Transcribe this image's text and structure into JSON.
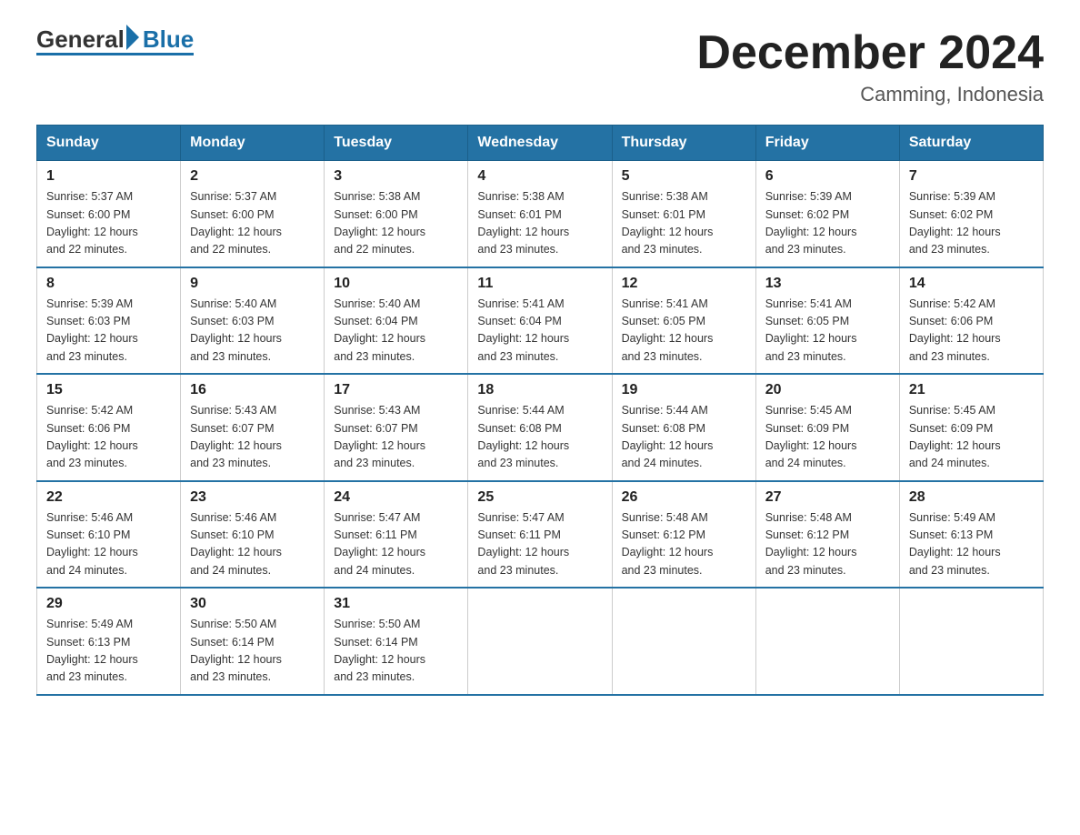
{
  "header": {
    "logo_general": "General",
    "logo_blue": "Blue",
    "month_title": "December 2024",
    "location": "Camming, Indonesia"
  },
  "columns": [
    "Sunday",
    "Monday",
    "Tuesday",
    "Wednesday",
    "Thursday",
    "Friday",
    "Saturday"
  ],
  "weeks": [
    [
      {
        "day": "1",
        "sunrise": "5:37 AM",
        "sunset": "6:00 PM",
        "daylight": "12 hours and 22 minutes."
      },
      {
        "day": "2",
        "sunrise": "5:37 AM",
        "sunset": "6:00 PM",
        "daylight": "12 hours and 22 minutes."
      },
      {
        "day": "3",
        "sunrise": "5:38 AM",
        "sunset": "6:00 PM",
        "daylight": "12 hours and 22 minutes."
      },
      {
        "day": "4",
        "sunrise": "5:38 AM",
        "sunset": "6:01 PM",
        "daylight": "12 hours and 23 minutes."
      },
      {
        "day": "5",
        "sunrise": "5:38 AM",
        "sunset": "6:01 PM",
        "daylight": "12 hours and 23 minutes."
      },
      {
        "day": "6",
        "sunrise": "5:39 AM",
        "sunset": "6:02 PM",
        "daylight": "12 hours and 23 minutes."
      },
      {
        "day": "7",
        "sunrise": "5:39 AM",
        "sunset": "6:02 PM",
        "daylight": "12 hours and 23 minutes."
      }
    ],
    [
      {
        "day": "8",
        "sunrise": "5:39 AM",
        "sunset": "6:03 PM",
        "daylight": "12 hours and 23 minutes."
      },
      {
        "day": "9",
        "sunrise": "5:40 AM",
        "sunset": "6:03 PM",
        "daylight": "12 hours and 23 minutes."
      },
      {
        "day": "10",
        "sunrise": "5:40 AM",
        "sunset": "6:04 PM",
        "daylight": "12 hours and 23 minutes."
      },
      {
        "day": "11",
        "sunrise": "5:41 AM",
        "sunset": "6:04 PM",
        "daylight": "12 hours and 23 minutes."
      },
      {
        "day": "12",
        "sunrise": "5:41 AM",
        "sunset": "6:05 PM",
        "daylight": "12 hours and 23 minutes."
      },
      {
        "day": "13",
        "sunrise": "5:41 AM",
        "sunset": "6:05 PM",
        "daylight": "12 hours and 23 minutes."
      },
      {
        "day": "14",
        "sunrise": "5:42 AM",
        "sunset": "6:06 PM",
        "daylight": "12 hours and 23 minutes."
      }
    ],
    [
      {
        "day": "15",
        "sunrise": "5:42 AM",
        "sunset": "6:06 PM",
        "daylight": "12 hours and 23 minutes."
      },
      {
        "day": "16",
        "sunrise": "5:43 AM",
        "sunset": "6:07 PM",
        "daylight": "12 hours and 23 minutes."
      },
      {
        "day": "17",
        "sunrise": "5:43 AM",
        "sunset": "6:07 PM",
        "daylight": "12 hours and 23 minutes."
      },
      {
        "day": "18",
        "sunrise": "5:44 AM",
        "sunset": "6:08 PM",
        "daylight": "12 hours and 23 minutes."
      },
      {
        "day": "19",
        "sunrise": "5:44 AM",
        "sunset": "6:08 PM",
        "daylight": "12 hours and 24 minutes."
      },
      {
        "day": "20",
        "sunrise": "5:45 AM",
        "sunset": "6:09 PM",
        "daylight": "12 hours and 24 minutes."
      },
      {
        "day": "21",
        "sunrise": "5:45 AM",
        "sunset": "6:09 PM",
        "daylight": "12 hours and 24 minutes."
      }
    ],
    [
      {
        "day": "22",
        "sunrise": "5:46 AM",
        "sunset": "6:10 PM",
        "daylight": "12 hours and 24 minutes."
      },
      {
        "day": "23",
        "sunrise": "5:46 AM",
        "sunset": "6:10 PM",
        "daylight": "12 hours and 24 minutes."
      },
      {
        "day": "24",
        "sunrise": "5:47 AM",
        "sunset": "6:11 PM",
        "daylight": "12 hours and 24 minutes."
      },
      {
        "day": "25",
        "sunrise": "5:47 AM",
        "sunset": "6:11 PM",
        "daylight": "12 hours and 23 minutes."
      },
      {
        "day": "26",
        "sunrise": "5:48 AM",
        "sunset": "6:12 PM",
        "daylight": "12 hours and 23 minutes."
      },
      {
        "day": "27",
        "sunrise": "5:48 AM",
        "sunset": "6:12 PM",
        "daylight": "12 hours and 23 minutes."
      },
      {
        "day": "28",
        "sunrise": "5:49 AM",
        "sunset": "6:13 PM",
        "daylight": "12 hours and 23 minutes."
      }
    ],
    [
      {
        "day": "29",
        "sunrise": "5:49 AM",
        "sunset": "6:13 PM",
        "daylight": "12 hours and 23 minutes."
      },
      {
        "day": "30",
        "sunrise": "5:50 AM",
        "sunset": "6:14 PM",
        "daylight": "12 hours and 23 minutes."
      },
      {
        "day": "31",
        "sunrise": "5:50 AM",
        "sunset": "6:14 PM",
        "daylight": "12 hours and 23 minutes."
      },
      null,
      null,
      null,
      null
    ]
  ]
}
